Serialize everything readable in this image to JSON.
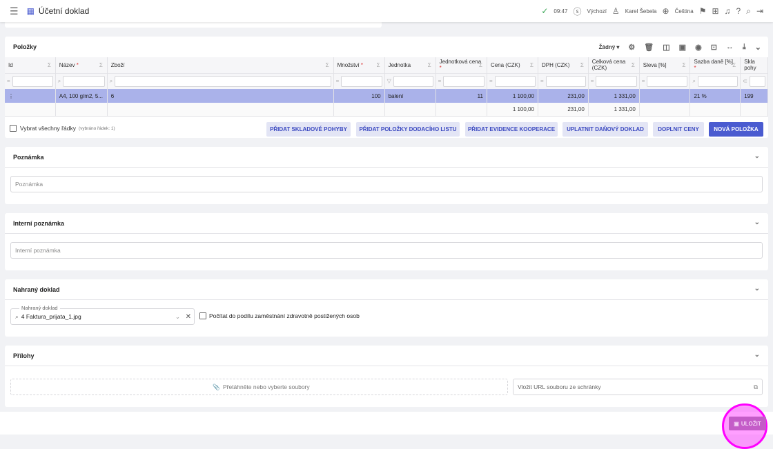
{
  "header": {
    "title": "Účetní doklad",
    "time": "09:47",
    "currency": "Výchozí",
    "user": "Karel Šebela",
    "language": "Čeština"
  },
  "items": {
    "title": "Položky",
    "view_select": "Žádný",
    "columns": [
      {
        "label": "Id",
        "req": ""
      },
      {
        "label": "Název",
        "req": "*"
      },
      {
        "label": "Zboží",
        "req": ""
      },
      {
        "label": "Množství",
        "req": "*"
      },
      {
        "label": "Jednotka",
        "req": ""
      },
      {
        "label": "Jednotková cena",
        "req": "*"
      },
      {
        "label": "Cena (CZK)",
        "req": ""
      },
      {
        "label": "DPH (CZK)",
        "req": ""
      },
      {
        "label": "Celková cena (CZK)",
        "req": ""
      },
      {
        "label": "Sleva [%]",
        "req": ""
      },
      {
        "label": "Sazba daně [%]",
        "req": "*"
      },
      {
        "label": "Skla pohy",
        "req": ""
      }
    ],
    "row": [
      "⋮",
      "A4, 100 g/m2, 5...",
      "6",
      "100",
      "balení",
      "11",
      "1 100,00",
      "231,00",
      "1 331,00",
      "",
      "21 %",
      "199"
    ],
    "summary": [
      "",
      "",
      "",
      "",
      "",
      "",
      "1 100,00",
      "231,00",
      "1 331,00",
      "",
      "",
      ""
    ],
    "select_all": "Vybrat všechny řádky",
    "selected_info": "(vybráno řádek: 1)",
    "buttons": [
      "PŘIDAT SKLADOVÉ POHYBY",
      "PŘIDAT POLOŽKY DODACÍHO LISTU",
      "PŘIDAT EVIDENCE KOOPERACE",
      "UPLATNIT DAŇOVÝ DOKLAD",
      "DOPLNIT CENY",
      "NOVÁ POLOŽKA"
    ]
  },
  "note": {
    "title": "Poznámka",
    "placeholder": "Poznámka"
  },
  "internal_note": {
    "title": "Interní poznámka",
    "placeholder": "Interní poznámka"
  },
  "uploaded": {
    "title": "Nahraný doklad",
    "field_label": "Nahraný doklad",
    "value": "4 Faktura_prijata_1.jpg",
    "checkbox": "Počítat do podílu zaměstnání zdravotně postižených osob"
  },
  "attachments": {
    "title": "Přílohy",
    "drop": "Přetáhněte nebo vyberte soubory",
    "url_placeholder": "Vložit URL souboru ze schránky"
  },
  "save": "ULOŽIT",
  "colors": {
    "accent": "#4a5bd0",
    "selected_row": "#aab2ea",
    "highlight": "#ff00ff"
  }
}
